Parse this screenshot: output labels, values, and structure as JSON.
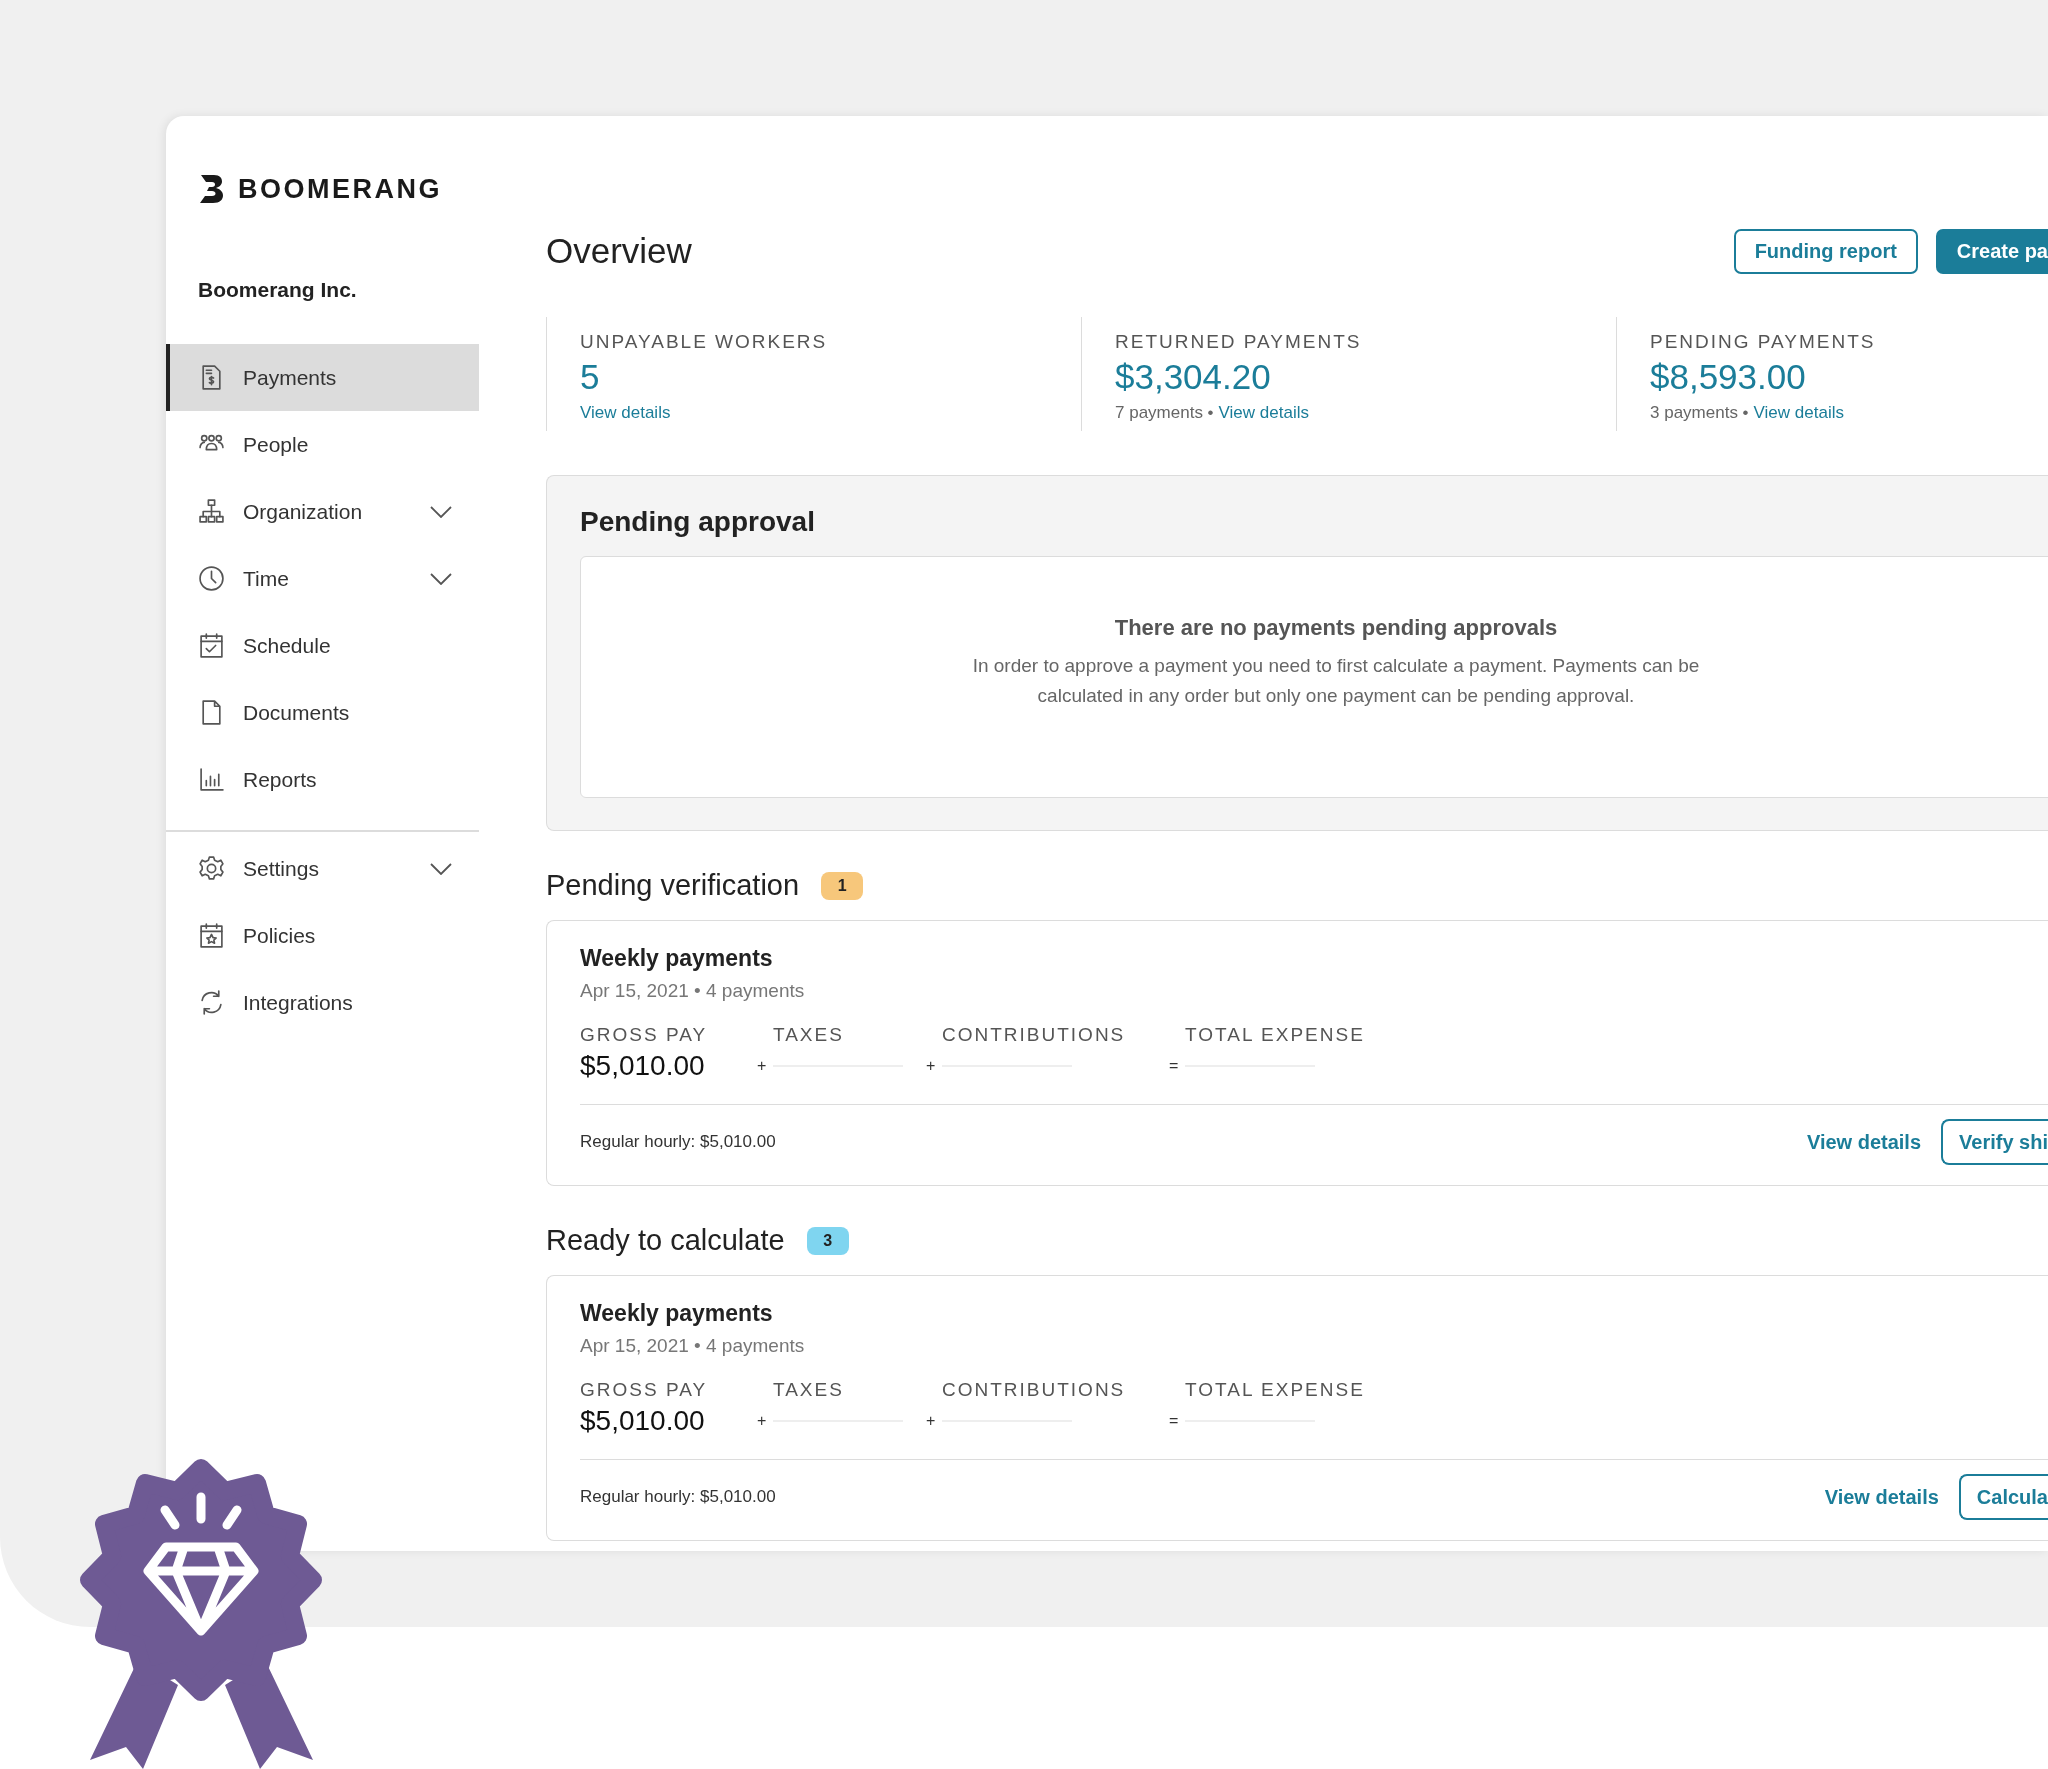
{
  "brand": {
    "name": "BOOMERANG"
  },
  "company": "Boomerang Inc.",
  "nav_main": [
    {
      "label": "Payments",
      "selected": true,
      "has_submenu": false
    },
    {
      "label": "People",
      "selected": false,
      "has_submenu": false
    },
    {
      "label": "Organization",
      "selected": false,
      "has_submenu": true
    },
    {
      "label": "Time",
      "selected": false,
      "has_submenu": true
    },
    {
      "label": "Schedule",
      "selected": false,
      "has_submenu": false
    },
    {
      "label": "Documents",
      "selected": false,
      "has_submenu": false
    },
    {
      "label": "Reports",
      "selected": false,
      "has_submenu": false
    }
  ],
  "nav_secondary": [
    {
      "label": "Settings",
      "selected": false,
      "has_submenu": true
    },
    {
      "label": "Policies",
      "selected": false,
      "has_submenu": false
    },
    {
      "label": "Integrations",
      "selected": false,
      "has_submenu": false
    }
  ],
  "page_title": "Overview",
  "buttons": [
    {
      "label": "Funding report",
      "kind": "outline"
    },
    {
      "label": "Create pa",
      "kind": "primary",
      "clipped": true
    }
  ],
  "stats": [
    {
      "label": "UNPAYABLE WORKERS",
      "value": "5",
      "link": "View details"
    },
    {
      "label": "RETURNED PAYMENTS",
      "value": "$3,304.20",
      "note": "7 payments •",
      "link": "View details"
    },
    {
      "label": "PENDING PAYMENTS",
      "value": "$8,593.00",
      "note": "3 payments •",
      "link": "View details"
    }
  ],
  "pending_approval": {
    "title": "Pending approval",
    "empty_title": "There are no payments pending approvals",
    "empty_text": "In order to approve a payment you need to first calculate a payment. Payments can be calculated in any order but only one payment can be pending approval."
  },
  "sections": [
    {
      "title": "Pending verification",
      "count": "1",
      "color": "#f7c77b",
      "cards": [
        {
          "title": "Weekly payments",
          "subtitle": "Apr 15, 2021 • 4 payments",
          "metrics": [
            {
              "label": "GROSS PAY",
              "value": "$5,010.00"
            },
            {
              "label": "TAXES",
              "operator": "+"
            },
            {
              "label": "CONTRIBUTIONS",
              "operator": "+"
            },
            {
              "label": "TOTAL EXPENSE",
              "operator": "="
            }
          ],
          "breakdown": "Regular hourly: $5,010.00",
          "actions": [
            {
              "label": "View details",
              "kind": "link"
            },
            {
              "label": "Verify shi",
              "kind": "outline",
              "clipped": true
            }
          ]
        }
      ]
    },
    {
      "title": "Ready to calculate",
      "count": "3",
      "color": "#7fd5f0",
      "cards": [
        {
          "title": "Weekly payments",
          "subtitle": "Apr 15, 2021 • 4 payments",
          "metrics": [
            {
              "label": "GROSS PAY",
              "value": "$5,010.00"
            },
            {
              "label": "TAXES",
              "operator": "+"
            },
            {
              "label": "CONTRIBUTIONS",
              "operator": "+"
            },
            {
              "label": "TOTAL EXPENSE",
              "operator": "="
            }
          ],
          "breakdown": "Regular hourly: $5,010.00",
          "actions": [
            {
              "label": "View details",
              "kind": "link"
            },
            {
              "label": "Calcula",
              "kind": "outline",
              "clipped": true
            }
          ]
        }
      ]
    }
  ]
}
